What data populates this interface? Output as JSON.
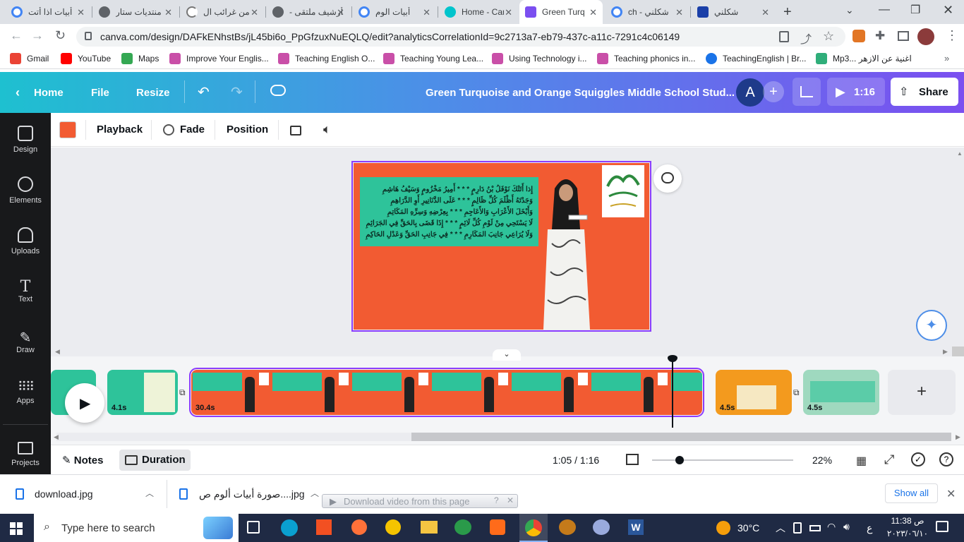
{
  "browser": {
    "tabs": [
      {
        "label": "أبيات اذا أتت"
      },
      {
        "label": "منتديات ستار"
      },
      {
        "label": "من غرائب ال"
      },
      {
        "label": "أرشيف ملتقى -"
      },
      {
        "label": "أبيات الوم"
      },
      {
        "label": "Home - Canva"
      },
      {
        "label": "Green Turquoise"
      },
      {
        "label": "شكلني - ch"
      },
      {
        "label": "شكلني"
      }
    ],
    "url": "canva.com/design/DAFkENhstBs/jL45bi6o_PpGfzuxNuEQLQ/edit?analyticsCorrelationId=9c2713a7-eb79-437c-a11c-7291c4c06149",
    "bookmarks": [
      "Gmail",
      "YouTube",
      "Maps",
      "Improve Your Englis...",
      "Teaching English O...",
      "Teaching Young Lea...",
      "Using Technology i...",
      "Teaching phonics in...",
      "TeachingEnglish | Br...",
      "Mp3... اغنية عن الازهر"
    ]
  },
  "canva": {
    "home": "Home",
    "file": "File",
    "resize": "Resize",
    "title": "Green Turquoise and Orange Squiggles Middle School Stud...",
    "avatar": "A",
    "play_time": "1:16",
    "share": "Share",
    "sidebar": [
      "Design",
      "Elements",
      "Uploads",
      "Text",
      "Draw",
      "Apps",
      "Projects"
    ],
    "toolbar": {
      "playback": "Playback",
      "fade": "Fade",
      "position": "Position"
    },
    "color_swatch": "#f25b32",
    "slide": {
      "poem": [
        "إِذا أَتَتْكَ نَوْفَلُ بْنُ دَارِمٍ * * * أَمِيرُ مَخْزُومٍ وَسَيْفُ هَاشِمِ",
        "وَجَدْتَهُ أَظْلَمَ كُلِّ ظَالِمٍ * * * عَلَى الدَّنَانِيرِ أَوِ الدَّرَاهِمِ",
        "وَأَبْخَلَ الأَعْرَابِ وَالأَعَاجِمِ * * * بِعِرْضِهِ وَسِرِّهِ المَكَاتِمِ",
        "لَا يَسْتَحِي مِنْ لَوْمِ كُلِّ لَائِمٍ * * * إِذَا قَضَى بِالحَقِّ فِي الجَرَائِمِ",
        "وَلَا يُرَاعِي جَانِبَ المَكَارِمِ * * * فِي جَانِبِ الحَقِّ وَعَدْلِ الحَاكِمِ"
      ]
    },
    "timeline": {
      "clips": [
        {
          "duration": "4.1s"
        },
        {
          "duration": "30.4s"
        },
        {
          "duration": "4.5s"
        },
        {
          "duration": "4.5s"
        }
      ]
    },
    "footer": {
      "notes": "Notes",
      "duration": "Duration",
      "time": "1:05 / 1:16",
      "zoom": "22%"
    }
  },
  "downloads": {
    "items": [
      "download.jpg",
      "صورة أبيات ألوم ص....jpg"
    ],
    "extension_bar": "Download video from this page",
    "show_all": "Show all"
  },
  "taskbar": {
    "search": "Type here to search",
    "weather": "30°C",
    "lang": "ع",
    "time": "11:38 ص",
    "date": "٢٠٢٣/٠٦/١٠"
  }
}
